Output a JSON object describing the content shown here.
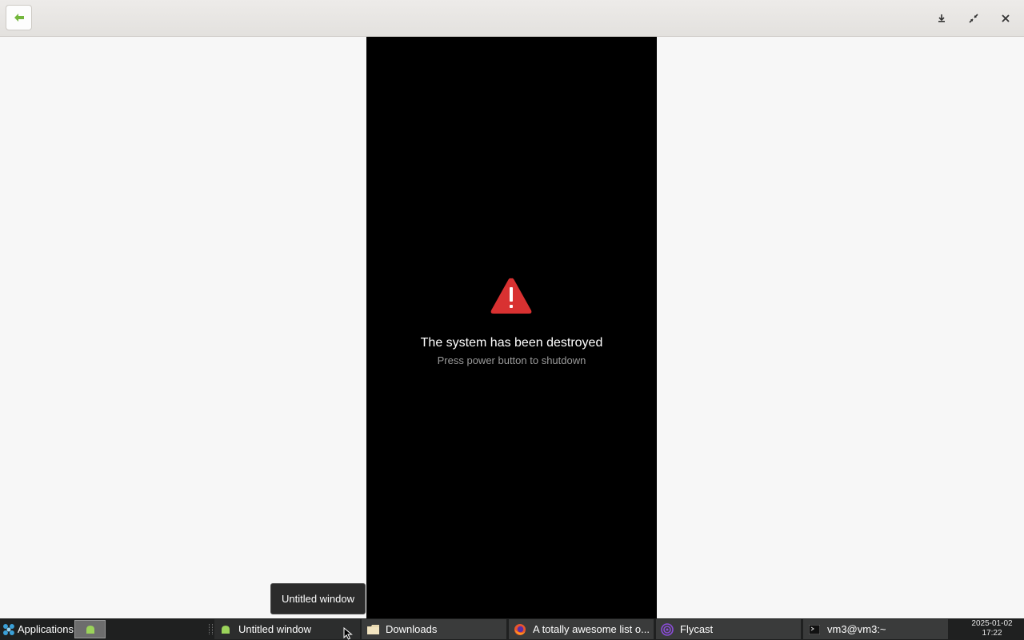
{
  "header": {
    "back_icon": "arrow-left-icon",
    "controls": [
      "download-icon",
      "unmaximize-icon",
      "close-icon"
    ],
    "back_color": "#73b63c"
  },
  "screen": {
    "alert_icon": "warning-triangle-icon",
    "alert_color": "#d93131",
    "title": "The system has been destroyed",
    "subtitle": "Press power button to shutdown"
  },
  "tooltip": {
    "text": "Untitled window"
  },
  "taskbar": {
    "applications_label": "Applications",
    "tasks": [
      {
        "label": "Untitled window",
        "icon": "android-icon",
        "active": true
      },
      {
        "label": "Downloads",
        "icon": "folder-icon",
        "active": false
      },
      {
        "label": "A totally awesome list o...",
        "icon": "firefox-icon",
        "active": false
      },
      {
        "label": "Flycast",
        "icon": "flycast-icon",
        "active": false
      },
      {
        "label": "vm3@vm3:~",
        "icon": "terminal-icon",
        "active": false
      }
    ],
    "clock": {
      "date": "2025-01-02",
      "time": "17:22"
    }
  }
}
